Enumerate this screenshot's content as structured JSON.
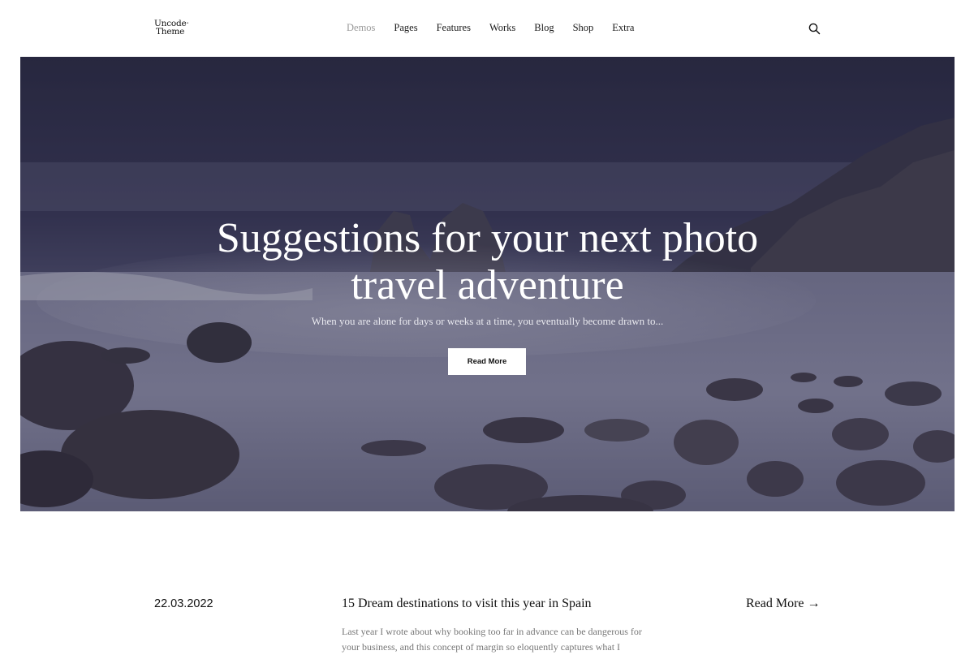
{
  "logo": {
    "line1": "Uncode",
    "line2": "Theme"
  },
  "nav": {
    "items": [
      {
        "label": "Demos"
      },
      {
        "label": "Pages"
      },
      {
        "label": "Features"
      },
      {
        "label": "Works"
      },
      {
        "label": "Blog"
      },
      {
        "label": "Shop"
      },
      {
        "label": "Extra"
      }
    ],
    "search_icon": "search-icon"
  },
  "hero": {
    "title_line1": "Suggestions for your next photo",
    "title_line2": "travel adventure",
    "subtitle": "When you are alone for days or weeks at a time, you eventually become drawn to...",
    "button_label": "Read More"
  },
  "post": {
    "date": "22.03.2022",
    "title": "15 Dream destinations to visit this year in Spain",
    "excerpt": "Last year I wrote about why booking too far in advance can be dangerous for your business, and this concept of margin so eloquently captures what I",
    "read_more": "Read More →"
  },
  "colors": {
    "accent_text": "#111111",
    "dimmed_nav": "#9a9a9a",
    "hero_overlay": "#2d2c48"
  }
}
